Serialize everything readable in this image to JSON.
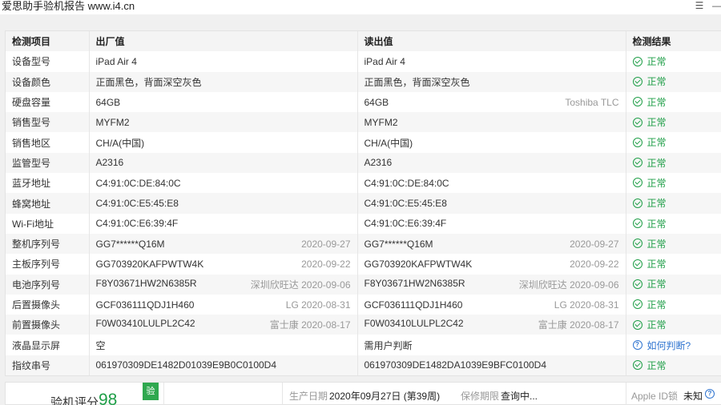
{
  "window": {
    "title": "爱思助手验机报告 www.i4.cn",
    "menu_icon": "list-icon",
    "minimize_icon": "minimize-icon"
  },
  "table": {
    "headers": [
      "检测项目",
      "出厂值",
      "读出值",
      "检测结果"
    ],
    "rows": [
      {
        "label": "设备型号",
        "factory": "iPad Air 4",
        "factory_extra": "",
        "read": "iPad Air 4",
        "read_extra": "",
        "result": "正常",
        "status": "ok"
      },
      {
        "label": "设备颜色",
        "factory": "正面黑色，背面深空灰色",
        "factory_extra": "",
        "read": "正面黑色，背面深空灰色",
        "read_extra": "",
        "result": "正常",
        "status": "ok"
      },
      {
        "label": "硬盘容量",
        "factory": "64GB",
        "factory_extra": "",
        "read": "64GB",
        "read_extra": "Toshiba TLC",
        "result": "正常",
        "status": "ok"
      },
      {
        "label": "销售型号",
        "factory": "MYFM2",
        "factory_extra": "",
        "read": "MYFM2",
        "read_extra": "",
        "result": "正常",
        "status": "ok"
      },
      {
        "label": "销售地区",
        "factory": "CH/A(中国)",
        "factory_extra": "",
        "read": "CH/A(中国)",
        "read_extra": "",
        "result": "正常",
        "status": "ok"
      },
      {
        "label": "监管型号",
        "factory": "A2316",
        "factory_extra": "",
        "read": "A2316",
        "read_extra": "",
        "result": "正常",
        "status": "ok"
      },
      {
        "label": "蓝牙地址",
        "factory": "C4:91:0C:DE:84:0C",
        "factory_extra": "",
        "read": "C4:91:0C:DE:84:0C",
        "read_extra": "",
        "result": "正常",
        "status": "ok"
      },
      {
        "label": "蜂窝地址",
        "factory": "C4:91:0C:E5:45:E8",
        "factory_extra": "",
        "read": "C4:91:0C:E5:45:E8",
        "read_extra": "",
        "result": "正常",
        "status": "ok"
      },
      {
        "label": "Wi-Fi地址",
        "factory": "C4:91:0C:E6:39:4F",
        "factory_extra": "",
        "read": "C4:91:0C:E6:39:4F",
        "read_extra": "",
        "result": "正常",
        "status": "ok"
      },
      {
        "label": "整机序列号",
        "factory": "GG7******Q16M",
        "factory_extra": "2020-09-27",
        "read": "GG7******Q16M",
        "read_extra": "2020-09-27",
        "result": "正常",
        "status": "ok"
      },
      {
        "label": "主板序列号",
        "factory": "GG703920KAFPWTW4K",
        "factory_extra": "2020-09-22",
        "read": "GG703920KAFPWTW4K",
        "read_extra": "2020-09-22",
        "result": "正常",
        "status": "ok"
      },
      {
        "label": "电池序列号",
        "factory": "F8Y03671HW2N6385R",
        "factory_extra": "深圳欣旺达 2020-09-06",
        "read": "F8Y03671HW2N6385R",
        "read_extra": "深圳欣旺达 2020-09-06",
        "result": "正常",
        "status": "ok"
      },
      {
        "label": "后置摄像头",
        "factory": "GCF036111QDJ1H460",
        "factory_extra": "LG 2020-08-31",
        "read": "GCF036111QDJ1H460",
        "read_extra": "LG 2020-08-31",
        "result": "正常",
        "status": "ok"
      },
      {
        "label": "前置摄像头",
        "factory": "F0W03410LULPL2C42",
        "factory_extra": "富士康 2020-08-17",
        "read": "F0W03410LULPL2C42",
        "read_extra": "富士康 2020-08-17",
        "result": "正常",
        "status": "ok"
      },
      {
        "label": "液晶显示屏",
        "factory": "空",
        "factory_extra": "",
        "read": "需用户判断",
        "read_extra": "",
        "result": "如何判断?",
        "status": "ask"
      },
      {
        "label": "指纹串号",
        "factory": "061970309DE1482D01039E9B0C0100D4",
        "factory_extra": "",
        "read": "061970309DE1482DA1039E9BFC0100D4",
        "read_extra": "",
        "result": "正常",
        "status": "ok"
      }
    ]
  },
  "summary": {
    "score_label": "验机评分",
    "score_value": "98",
    "badge": "验",
    "production_date_label": "生产日期",
    "production_date": "2020年09月27日 (第39周)",
    "warranty_label": "保修期限",
    "warranty_value": "查询中...",
    "apple_id_label": "Apple ID锁",
    "apple_id_value": "未知",
    "help_icon": "question-circle-icon"
  },
  "colors": {
    "ok": "#1e9e47",
    "link": "#2f74d0",
    "badge": "#2fa84f"
  }
}
